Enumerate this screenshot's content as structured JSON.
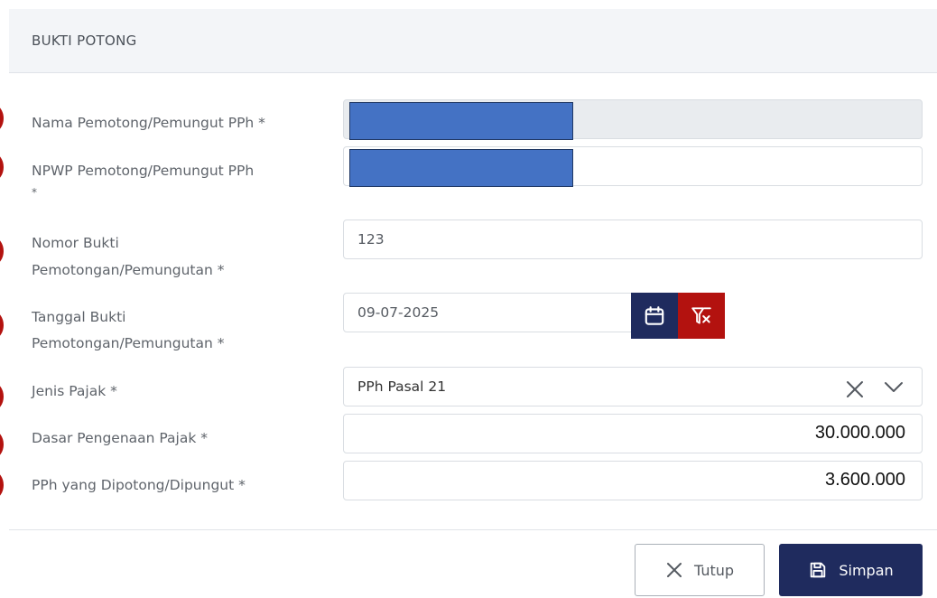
{
  "header": {
    "title": "BUKTI POTONG"
  },
  "fields": {
    "nama": {
      "label": "Nama Pemotong/Pemungut PPh *",
      "value": ""
    },
    "npwp": {
      "label_line1": "NPWP Pemotong/Pemungut PPh",
      "label_line2": "*",
      "value": ""
    },
    "nomor": {
      "label_line1": "Nomor Bukti",
      "label_line2": "Pemotongan/Pemungutan *",
      "value": "123"
    },
    "tanggal": {
      "label_line1": "Tanggal Bukti",
      "label_line2": "Pemotongan/Pemungutan *",
      "value": "09-07-2025"
    },
    "jenis": {
      "label": "Jenis Pajak *",
      "value": "PPh Pasal 21"
    },
    "dasar": {
      "label": "Dasar Pengenaan Pajak *",
      "value": "30.000.000"
    },
    "pph": {
      "label": "PPh yang Dipotong/Dipungut *",
      "value": "3.600.000"
    }
  },
  "buttons": {
    "close_label": "Tutup",
    "save_label": "Simpan"
  },
  "icons": {
    "calendar": "calendar-icon",
    "clear_filter": "filter-clear-icon",
    "clear": "close-icon",
    "chevron": "chevron-down-icon",
    "save": "save-icon"
  },
  "colors": {
    "primary": "#1f2b5e",
    "danger": "#b3120f",
    "redaction": "#4472c4"
  }
}
